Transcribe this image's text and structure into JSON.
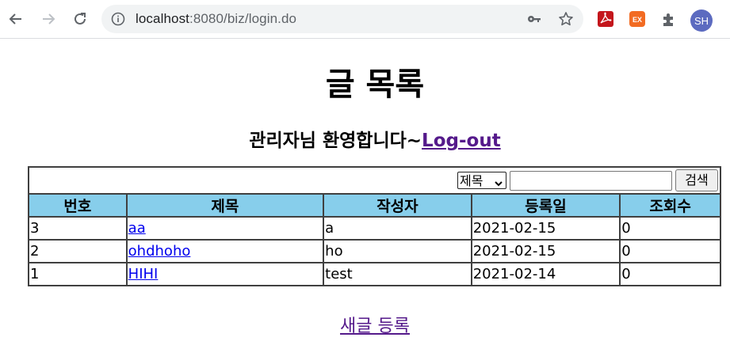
{
  "browser": {
    "url_host": "localhost",
    "url_rest": ":8080/biz/login.do",
    "avatar_initials": "SH",
    "extensions": [
      "pdf-extension-icon",
      "ex-extension-icon",
      "puzzle-icon"
    ]
  },
  "page": {
    "title": "글 목록",
    "welcome_text": "관리자님 환영합니다~",
    "logout_label": "Log-out",
    "new_post_label": "새글 등록"
  },
  "search": {
    "condition_selected": "제목",
    "keyword_value": "",
    "button_label": "검색"
  },
  "board": {
    "columns": [
      "번호",
      "제목",
      "작성자",
      "등록일",
      "조회수"
    ],
    "rows": [
      {
        "seq": "3",
        "title": "aa",
        "writer": "a",
        "regdate": "2021-02-15",
        "cnt": "0"
      },
      {
        "seq": "2",
        "title": "ohdhoho",
        "writer": "ho",
        "regdate": "2021-02-15",
        "cnt": "0"
      },
      {
        "seq": "1",
        "title": "HIHI",
        "writer": "test",
        "regdate": "2021-02-14",
        "cnt": "0"
      }
    ]
  },
  "colors": {
    "header_bg": "#87ceeb",
    "visited_link": "#551a8b",
    "link": "#0000ee"
  }
}
